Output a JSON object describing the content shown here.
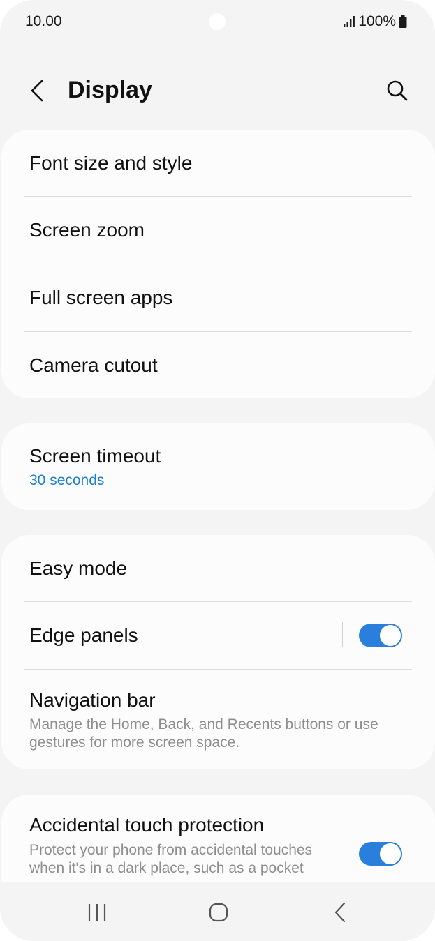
{
  "status": {
    "time": "10.00",
    "battery": "100%"
  },
  "header": {
    "title": "Display"
  },
  "card1": {
    "items": [
      {
        "label": "Font size and style"
      },
      {
        "label": "Screen zoom"
      },
      {
        "label": "Full screen apps"
      },
      {
        "label": "Camera cutout"
      }
    ]
  },
  "card2": {
    "screen_timeout": {
      "label": "Screen timeout",
      "value": "30 seconds"
    }
  },
  "card3": {
    "easy_mode": {
      "label": "Easy mode"
    },
    "edge_panels": {
      "label": "Edge panels",
      "enabled": true
    },
    "navigation_bar": {
      "label": "Navigation bar",
      "description": "Manage the Home, Back, and Recents buttons or use gestures for more screen space."
    }
  },
  "card4": {
    "accidental_touch": {
      "label": "Accidental touch protection",
      "description": "Protect your phone from accidental touches when it's in a dark place, such as a pocket",
      "enabled": true
    }
  },
  "colors": {
    "accent": "#2a7fdd",
    "value_blue": "#1a7fd1",
    "background": "#f4f4f4",
    "card": "#fcfcfc"
  },
  "icons": [
    "back-arrow-icon",
    "search-icon",
    "signal-icon",
    "battery-icon",
    "recents-icon",
    "home-icon",
    "nav-back-icon"
  ]
}
